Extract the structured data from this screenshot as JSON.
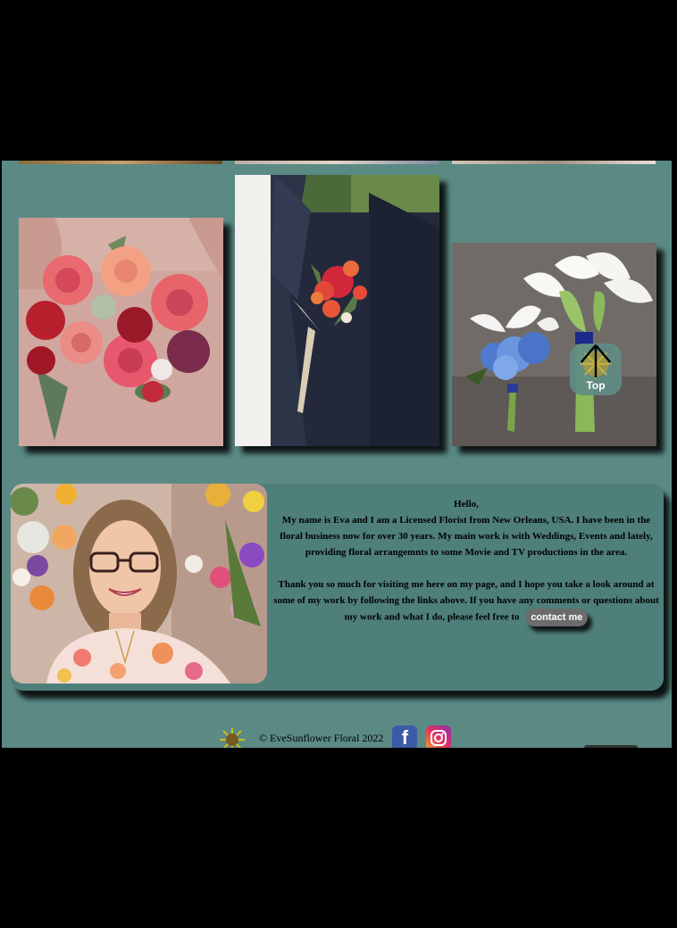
{
  "gallery": {
    "top_strips": [
      "image-strip-1",
      "image-strip-2",
      "image-strip-3"
    ],
    "photos": [
      {
        "name": "bridal-bouquet-photo",
        "alt": "bridal bouquet"
      },
      {
        "name": "boutonniere-photo",
        "alt": "boutonniere"
      },
      {
        "name": "calla-lily-bouquets-photo",
        "alt": "calla lily bouquets"
      }
    ]
  },
  "top_button": {
    "label": "Top"
  },
  "about": {
    "greeting": "Hello,",
    "paragraph1": "My name is Eva and I am a Licensed Florist from New Orleans, USA. I have been in the floral business now for over 30 years. My main work is with Weddings, Events and lately, providing floral arrangemnts to some Movie and TV productions in the area.",
    "paragraph2_text": "Thank you so much for visiting me here on my page, and I hope you take a look around at some of my work by following the links above. If you have any comments or questions about my work and what I do, please feel free to",
    "contact_label": "contact me"
  },
  "footer": {
    "copyright": "© EveSunflower Floral 2022",
    "facebook_icon": "facebook-icon",
    "instagram_icon": "instagram-icon"
  },
  "colors": {
    "page_bg": "#5b8a85",
    "card_bg": "#4f7f7b",
    "button_bg": "#6b6b6b"
  }
}
